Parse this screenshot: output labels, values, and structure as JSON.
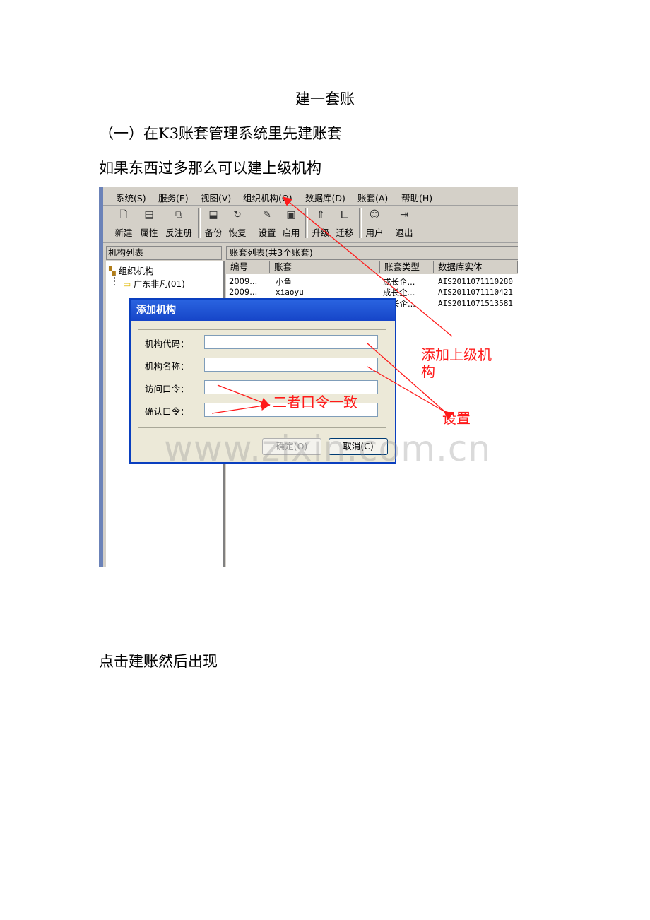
{
  "doc": {
    "title": "建一套账",
    "line1": "（一）在K3账套管理系统里先建账套",
    "line2": "如果东西过多那么可以建上级机构",
    "footer": "点击建账然后出现"
  },
  "menubar": {
    "items": [
      "系统(S)",
      "服务(E)",
      "视图(V)",
      "组织机构(O)",
      "数据库(D)",
      "账套(A)",
      "帮助(H)"
    ]
  },
  "toolbar": {
    "buttons": [
      {
        "label": "新建",
        "icon": "new-document-icon"
      },
      {
        "label": "属性",
        "icon": "properties-icon"
      },
      {
        "label": "反注册",
        "icon": "unregister-icon"
      },
      {
        "label": "备份",
        "icon": "backup-icon"
      },
      {
        "label": "恢复",
        "icon": "restore-icon"
      },
      {
        "label": "设置",
        "icon": "settings-icon"
      },
      {
        "label": "启用",
        "icon": "enable-icon"
      },
      {
        "label": "升级",
        "icon": "upgrade-icon"
      },
      {
        "label": "迁移",
        "icon": "migrate-icon"
      },
      {
        "label": "用户",
        "icon": "user-icon"
      },
      {
        "label": "退出",
        "icon": "exit-icon"
      }
    ]
  },
  "left_pane": {
    "title": "机构列表",
    "root": "组织机构",
    "child": "广东非凡(01)"
  },
  "right_pane": {
    "title": "账套列表(共3个账套)",
    "columns": [
      "编号",
      "账套",
      "账套类型",
      "数据库实体"
    ],
    "rows": [
      [
        "2009...",
        "小鱼",
        "成长企...",
        "AIS2011071110280"
      ],
      [
        "2009...",
        "xiaoyu",
        "成长企...",
        "AIS2011071110421"
      ],
      [
        "",
        "",
        "长企...",
        "AIS2011071513581"
      ]
    ]
  },
  "dialog": {
    "title": "添加机构",
    "fields": [
      {
        "label": "机构代码：",
        "value": ""
      },
      {
        "label": "机构名称：",
        "value": ""
      },
      {
        "label": "访问口令：",
        "value": ""
      },
      {
        "label": "确认口令：",
        "value": ""
      }
    ],
    "ok_label": "确定(O)",
    "cancel_label": "取消(C)"
  },
  "annotations": {
    "add_parent_line1": "添加上级机",
    "add_parent_line2": "构",
    "settings": "设置",
    "passwords_match": "二者口令一致",
    "color": "#ff1a1a"
  },
  "watermark": "www.zixin.com.cn"
}
